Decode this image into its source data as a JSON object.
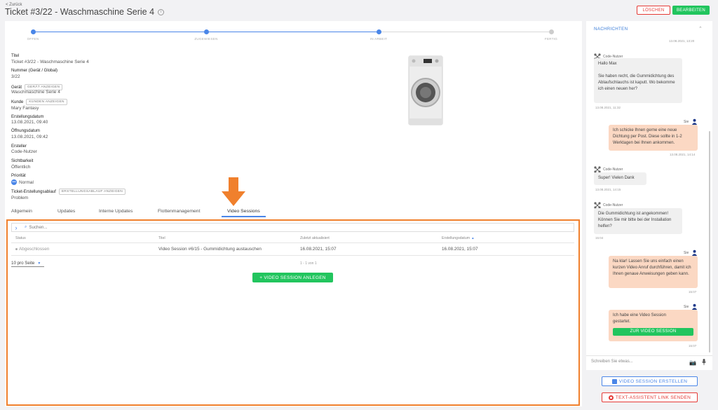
{
  "header": {
    "back": "< Zurück",
    "title": "Ticket #3/22 - Waschmaschine Serie 4",
    "delete_label": "LÖSCHEN",
    "edit_label": "BEARBEITEN"
  },
  "progress": {
    "steps": [
      "OFFEN",
      "ZUGEWIESEN",
      "IN ARBEIT",
      "FERTIG"
    ],
    "current_step": 3
  },
  "details": {
    "title_label": "Titel",
    "title_value": "Ticket #3/22 - Waschmaschine Serie 4",
    "number_label": "Nummer (Gerät / Global)",
    "number_value": "3/22",
    "device_label": "Gerät",
    "device_button": "GERÄT ANZEIGEN",
    "device_value": "Waschmaschine Serie 4",
    "customer_label": "Kunde",
    "customer_button": "KUNDEN ANZEIGEN",
    "customer_value": "Mary Fantasy",
    "created_label": "Erstellungsdatum",
    "created_value": "13.08.2021, 09:40",
    "opened_label": "Öffnungsdatum",
    "opened_value": "13.08.2021, 09:42",
    "creator_label": "Ersteller",
    "creator_value": "Code-Nutzer",
    "visibility_label": "Sichtbarkeit",
    "visibility_value": "Öffentlich",
    "priority_label": "Priorität",
    "priority_value": "Normal",
    "flow_label": "Ticket-Erstellungsablauf",
    "flow_button": "ERSTELLUNGSABLAUF ANZEIGEN",
    "flow_value": "Problem"
  },
  "tabs": [
    "Allgemein",
    "Updates",
    "Interne Updates",
    "Flottenmanagement",
    "Video Sessions"
  ],
  "active_tab": "Video Sessions",
  "table": {
    "search_placeholder": "Suchen...",
    "columns": [
      "Status",
      "Titel",
      "Zuletzt aktualisiert",
      "Erstellungsdatum"
    ],
    "sort_indicator": "▲",
    "rows": [
      {
        "status": "Abgeschlossen",
        "title": "Video Session #6/15 - Gummidichtung austauschen",
        "updated": "16.08.2021, 15:07",
        "created": "16.08.2021, 15:07"
      }
    ],
    "page_size": "10 pro Seite",
    "page_info": "1 - 1 von 1",
    "create_button": "+ VIDEO SESSION ANLEGEN"
  },
  "chat": {
    "header": "NACHRICHTEN",
    "top_timestamp": "13.08.2021, 13:20",
    "messages": [
      {
        "from": "Code-Nutzer",
        "text": "Hallo Max\n\nSie haben recht, die Gummidichtung des Ablaufschlauchs ist kaputt. Wo bekomme ich einen neuen her?",
        "time": "13.08.2021, 11:32"
      },
      {
        "from": "Sie",
        "text": "Ich schicke Ihnen gerne eine neue Dichtung per Post. Diese sollte in 1-2 Werktagen bei Ihnen ankommen.",
        "time": "13.08.2021, 14:14"
      },
      {
        "from": "Code-Nutzer",
        "text": "Super! Vielen Dank",
        "time": "13.08.2021, 14:15"
      },
      {
        "from": "Code-Nutzer",
        "text": "Die Gummidichtung ist angekommen! Können Sie mir bitte bei der Installation helfen?",
        "time": "15:04"
      },
      {
        "from": "Sie",
        "text": "Na klar! Lassen Sie uns einfach einen kurzen Video Anruf durchführen, damit ich Ihnen genaue Anweisungen geben kann.",
        "time": "15:07"
      },
      {
        "from": "Sie",
        "text": "Ich habe eine Video Session gestartet.",
        "button": "ZUR VIDEO SESSION",
        "time": "15:07"
      }
    ],
    "composer_placeholder": "Schreiben Sie etwas...",
    "video_button": "VIDEO SESSION ERSTELLEN",
    "text_assistant_button": "TEXT-ASSISTENT LINK SENDEN"
  },
  "colors": {
    "accent": "#4a86e8",
    "green": "#22c55e",
    "red": "#e53935",
    "highlight": "#f0802d",
    "outgoing_bubble": "#fbd8c3"
  }
}
